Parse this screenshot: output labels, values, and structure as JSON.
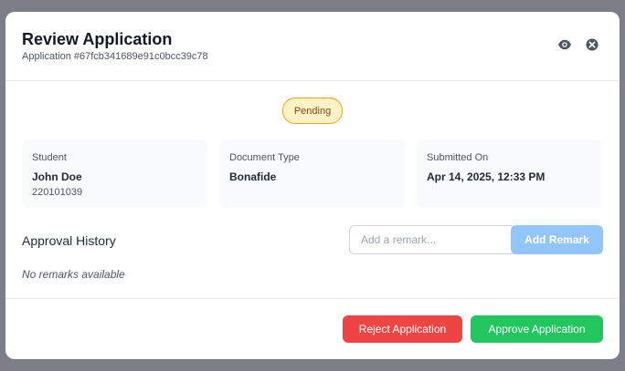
{
  "header": {
    "title": "Review Application",
    "application_id": "Application #67fcb341689e91c0bcc39c78"
  },
  "status": {
    "label": "Pending",
    "color": "#f59e0b"
  },
  "details": {
    "student": {
      "label": "Student",
      "name": "John Doe",
      "id": "220101039"
    },
    "document_type": {
      "label": "Document Type",
      "value": "Bonafide"
    },
    "submitted_on": {
      "label": "Submitted On",
      "value": "Apr 14, 2025, 12:33 PM"
    }
  },
  "history": {
    "title": "Approval History",
    "remark_placeholder": "Add a remark...",
    "add_label": "Add Remark",
    "empty_text": "No remarks available"
  },
  "actions": {
    "reject_label": "Reject Application",
    "approve_label": "Approve Application"
  },
  "icons": {
    "view": "eye-icon",
    "close": "close-icon"
  },
  "colors": {
    "reject": "#ef4444",
    "approve": "#22c55e",
    "add_remark": "#93c5fd"
  }
}
